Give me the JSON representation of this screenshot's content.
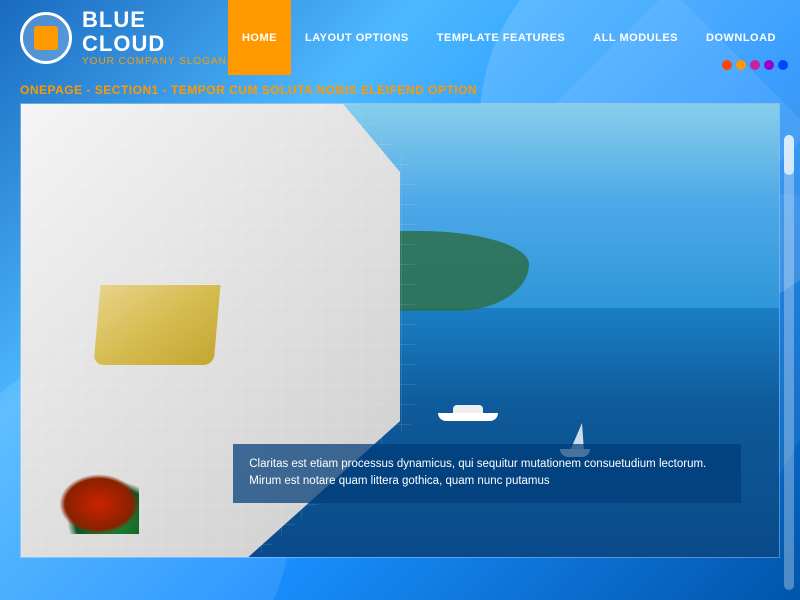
{
  "logo": {
    "title": "BLUE CLOUD",
    "slogan": "YOUR COMPANY SLOGAN"
  },
  "nav": {
    "items": [
      {
        "id": "home",
        "label": "HOME",
        "active": true
      },
      {
        "id": "layout-options",
        "label": "LAYOUT OPTIONS",
        "active": false
      },
      {
        "id": "template-features",
        "label": "TEMPLATE FEATURES",
        "active": false
      },
      {
        "id": "all-modules",
        "label": "ALL MODULES",
        "active": false
      },
      {
        "id": "download",
        "label": "DOWNLOAD",
        "active": false
      }
    ]
  },
  "color_dots": [
    {
      "color": "#ff4400"
    },
    {
      "color": "#ff9900"
    },
    {
      "color": "#cc2299"
    },
    {
      "color": "#9900cc"
    },
    {
      "color": "#0044ff"
    }
  ],
  "section": {
    "label": "ONEPAGE - SECTION1 - TEMPOR CUM SOLUTA NOBIS ELEIFEND OPTION"
  },
  "hero": {
    "caption": "Claritas est etiam processus dynamicus, qui sequitur mutationem consuetudium lectorum. Mirum est notare quam littera gothica, quam nunc putamus"
  }
}
